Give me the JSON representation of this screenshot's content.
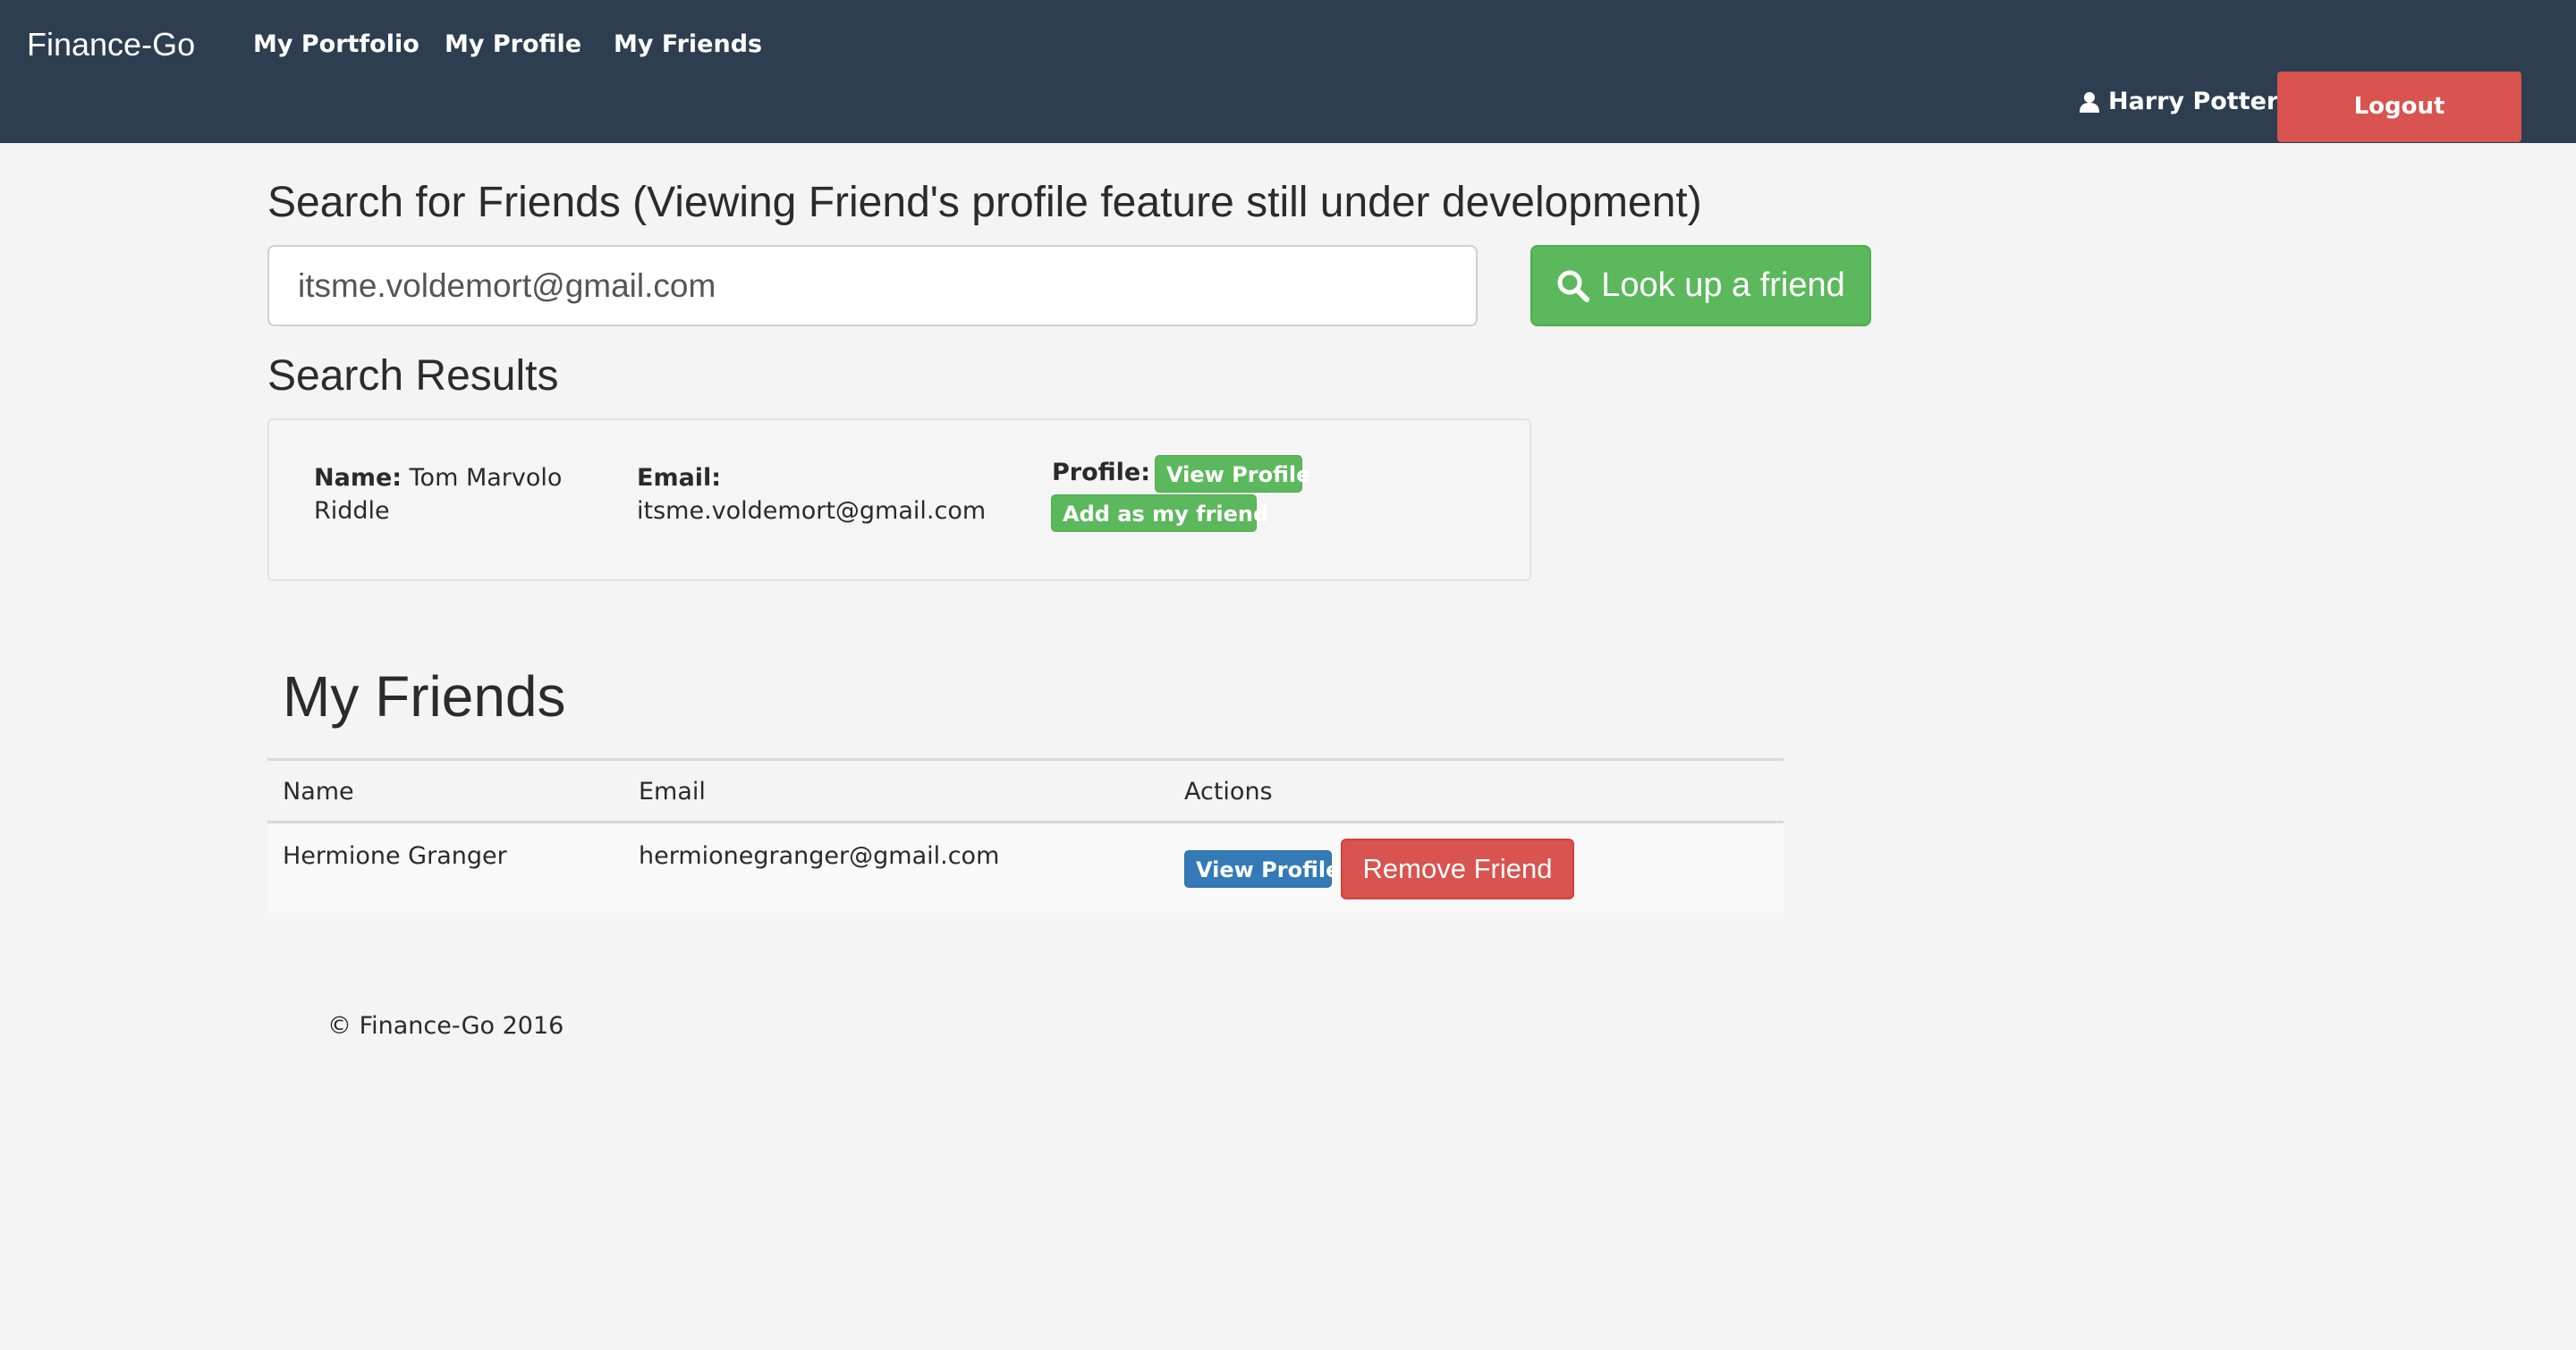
{
  "navbar": {
    "brand": "Finance-Go",
    "links": [
      "My Portfolio",
      "My Profile",
      "My Friends"
    ],
    "user_name": "Harry Potter",
    "user_icon": "user-icon",
    "logout_label": "Logout"
  },
  "search": {
    "heading": "Search for Friends (Viewing Friend's profile feature still under development)",
    "input_value": "itsme.voldemort@gmail.com",
    "button_label": "Look up a friend",
    "button_icon": "search-icon"
  },
  "results": {
    "heading": "Search Results",
    "name_label": "Name:",
    "name_value": "Tom Marvolo Riddle",
    "email_label": "Email:",
    "email_value": "itsme.voldemort@gmail.com",
    "profile_label": "Profile:",
    "view_profile_label": "View Profile",
    "add_friend_label": "Add as my friend"
  },
  "friends": {
    "heading": "My Friends",
    "columns": [
      "Name",
      "Email",
      "Actions"
    ],
    "rows": [
      {
        "name": "Hermione Granger",
        "email": "hermionegranger@gmail.com",
        "view_label": "View Profile",
        "remove_label": "Remove Friend"
      }
    ]
  },
  "footer": {
    "text": "© Finance-Go 2016"
  },
  "colors": {
    "navbar": "#2c3e4f",
    "success": "#5cb85c",
    "danger": "#d9534f",
    "primary": "#337ab7",
    "background": "#f4f4f4"
  }
}
